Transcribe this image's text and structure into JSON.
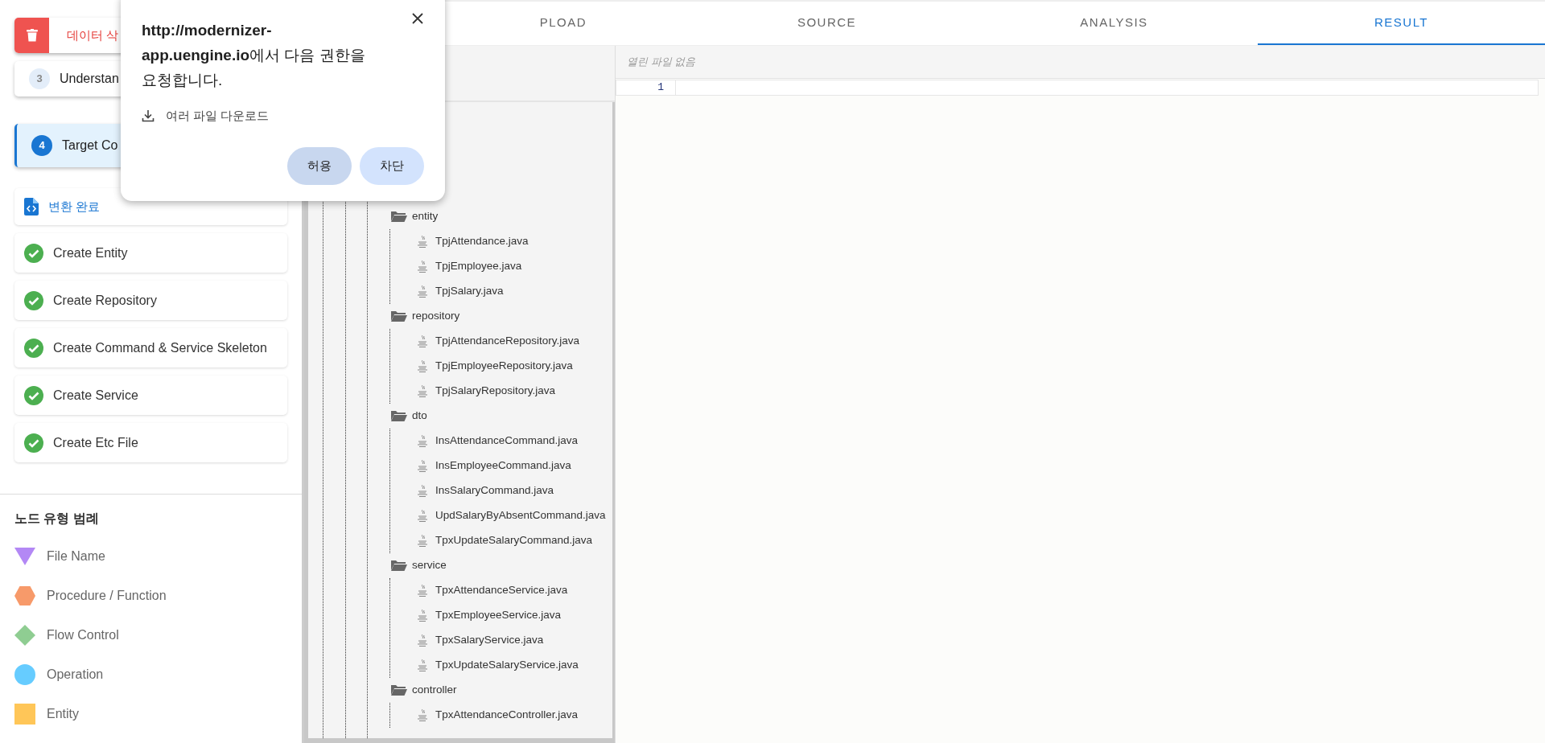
{
  "delete_button": {
    "label": "데이터 삭"
  },
  "steps": [
    {
      "number": "3",
      "title": "Understan",
      "selected": false
    },
    {
      "number": "4",
      "title": "Target Co",
      "selected": true
    }
  ],
  "result_card": {
    "label": "변환 완료"
  },
  "tasks": [
    {
      "label": "Create Entity",
      "done": true
    },
    {
      "label": "Create Repository",
      "done": true
    },
    {
      "label": "Create Command & Service Skeleton",
      "done": true
    },
    {
      "label": "Create Service",
      "done": true
    },
    {
      "label": "Create Etc File",
      "done": true
    }
  ],
  "legend": {
    "title": "노드 유형 범례",
    "items": [
      {
        "kind": "triangle",
        "label": "File Name",
        "color": "#b388f5"
      },
      {
        "kind": "hexagon",
        "label": "Procedure / Function",
        "color": "#f79a6a"
      },
      {
        "kind": "diamond",
        "label": "Flow Control",
        "color": "#8fcd92"
      },
      {
        "kind": "circle",
        "label": "Operation",
        "color": "#66ccff"
      },
      {
        "kind": "square",
        "label": "Entity",
        "color": "#ffc658"
      }
    ]
  },
  "tabs": [
    {
      "label": "PLOAD",
      "selected": false
    },
    {
      "label": "SOURCE",
      "selected": false
    },
    {
      "label": "ANALYSIS",
      "selected": false
    },
    {
      "label": "RESULT",
      "selected": true
    }
  ],
  "tree": [
    {
      "kind": "folder",
      "label": "entity",
      "children": [
        {
          "kind": "file",
          "label": "TpjAttendance.java"
        },
        {
          "kind": "file",
          "label": "TpjEmployee.java"
        },
        {
          "kind": "file",
          "label": "TpjSalary.java"
        }
      ]
    },
    {
      "kind": "folder",
      "label": "repository",
      "children": [
        {
          "kind": "file",
          "label": "TpjAttendanceRepository.java"
        },
        {
          "kind": "file",
          "label": "TpjEmployeeRepository.java"
        },
        {
          "kind": "file",
          "label": "TpjSalaryRepository.java"
        }
      ]
    },
    {
      "kind": "folder",
      "label": "dto",
      "children": [
        {
          "kind": "file",
          "label": "InsAttendanceCommand.java"
        },
        {
          "kind": "file",
          "label": "InsEmployeeCommand.java"
        },
        {
          "kind": "file",
          "label": "InsSalaryCommand.java"
        },
        {
          "kind": "file",
          "label": "UpdSalaryByAbsentCommand.java"
        },
        {
          "kind": "file",
          "label": "TpxUpdateSalaryCommand.java"
        }
      ]
    },
    {
      "kind": "folder",
      "label": "service",
      "children": [
        {
          "kind": "file",
          "label": "TpxAttendanceService.java"
        },
        {
          "kind": "file",
          "label": "TpxEmployeeService.java"
        },
        {
          "kind": "file",
          "label": "TpxSalaryService.java"
        },
        {
          "kind": "file",
          "label": "TpxUpdateSalaryService.java"
        }
      ]
    },
    {
      "kind": "folder",
      "label": "controller",
      "children": [
        {
          "kind": "file",
          "label": "TpxAttendanceController.java"
        }
      ]
    }
  ],
  "editor": {
    "header": "열린 파일 없음",
    "line_numbers": [
      "1"
    ]
  },
  "permission_popup": {
    "message": "**http://modernizer-app.uengine.io**에서 다음 권한을 요청합니다.",
    "permission": "여러 파일 다운로드",
    "buttons": [
      {
        "label": "허용",
        "kind": "allow"
      },
      {
        "label": "차단",
        "kind": "block"
      }
    ]
  }
}
